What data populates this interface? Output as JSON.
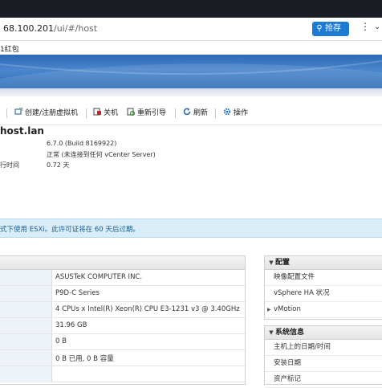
{
  "browser": {
    "url_host": "68.100.201",
    "url_path": "/ui/#/host",
    "store_label": "抢存",
    "more_glyph": "⋮",
    "chevron_glyph": "⌄",
    "bookmark": "1红包"
  },
  "toolbar": {
    "items": [
      {
        "label": "创建/注册虚拟机",
        "icon": "vm-create-icon"
      },
      {
        "label": "关机",
        "icon": "shutdown-icon"
      },
      {
        "label": "重新引导",
        "icon": "reboot-icon"
      },
      {
        "label": "刷新",
        "icon": "refresh-icon"
      },
      {
        "label": "操作",
        "icon": "gear-icon"
      }
    ]
  },
  "host": {
    "name": "host.lan",
    "fields": [
      {
        "label": "",
        "value": "6.7.0 (Build 8169922)"
      },
      {
        "label": "",
        "value": "正常 (未连接到任何 vCenter Server)"
      },
      {
        "label": "行时间",
        "value": "0.72 天"
      }
    ]
  },
  "license_banner": "式下使用 ESXi。此许可证将在 60 天后过期。",
  "hardware": {
    "values": [
      "ASUSTeK COMPUTER INC.",
      "P9D-C Series",
      "4 CPUs x Intel(R) Xeon(R) CPU E3-1231 v3 @ 3.40GHz",
      "31.96 GB",
      "0 B",
      "0 B 已用, 0 B 容量",
      ""
    ]
  },
  "config_panel": {
    "title": "配置",
    "items": [
      {
        "label": "映像配置文件",
        "expandable": false
      },
      {
        "label": "vSphere HA 状况",
        "expandable": false
      },
      {
        "label": "vMotion",
        "expandable": true
      }
    ]
  },
  "sysinfo_panel": {
    "title": "系统信息",
    "items": [
      {
        "label": "主机上的日期/时间"
      },
      {
        "label": "安装日期"
      },
      {
        "label": "资产标记"
      }
    ]
  },
  "colors": {
    "header_blue": "#2c69b6",
    "store_button": "#1e7bd3",
    "banner_bg": "#d9edf8",
    "banner_text": "#1d5b91"
  }
}
